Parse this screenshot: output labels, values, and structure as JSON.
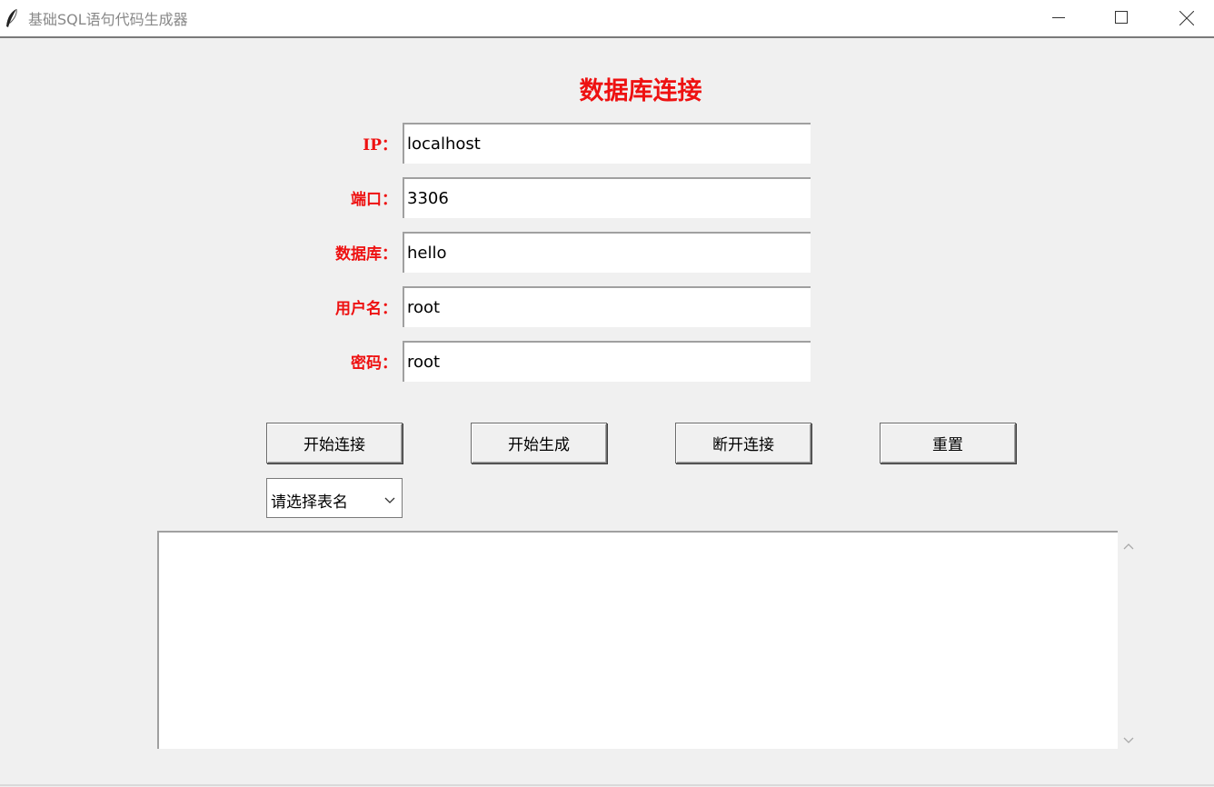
{
  "window": {
    "title": "基础SQL语句代码生成器",
    "icon": "feather-icon"
  },
  "form": {
    "heading": "数据库连接",
    "fields": [
      {
        "label": "IP：",
        "value": "localhost"
      },
      {
        "label": "端口：",
        "value": "3306"
      },
      {
        "label": "数据库：",
        "value": "hello"
      },
      {
        "label": "用户名：",
        "value": "root"
      },
      {
        "label": "密码：",
        "value": "root"
      }
    ]
  },
  "buttons": {
    "connect": "开始连接",
    "generate": "开始生成",
    "disconnect": "断开连接",
    "reset": "重置"
  },
  "table_select": {
    "selected": "请选择表名"
  },
  "output": {
    "text": ""
  },
  "colors": {
    "accent": "#ee1111",
    "background": "#f0f0f0"
  }
}
